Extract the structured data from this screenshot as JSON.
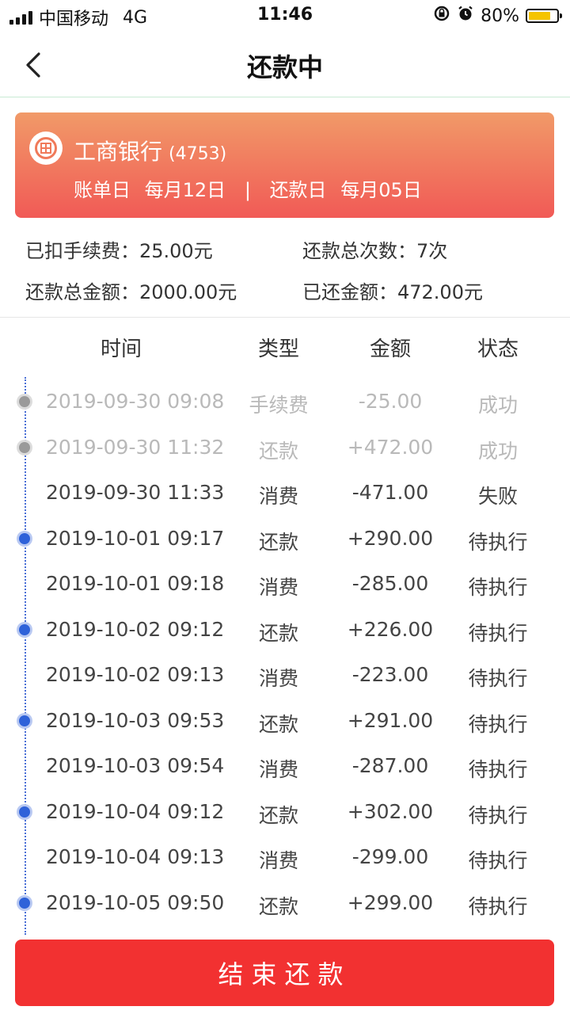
{
  "status_bar": {
    "carrier": "中国移动",
    "network": "4G",
    "time": "11:46",
    "battery": "80%",
    "battery_level": 0.8,
    "icons": [
      "signal-icon",
      "orientation-lock-icon",
      "alarm-icon",
      "battery-icon"
    ]
  },
  "nav": {
    "title": "还款中",
    "back_icon": "chevron-left-icon"
  },
  "card": {
    "bank_name": "工商银行",
    "card_no": "(4753)",
    "bill_label": "账单日",
    "bill_day": "每月12日",
    "separator": "|",
    "repay_label": "还款日",
    "repay_day": "每月05日",
    "gradient_colors": [
      "#f19a68",
      "#f15a56"
    ],
    "logo_icon": "icbc-logo-icon"
  },
  "summary": {
    "fee": "已扣手续费：25.00元",
    "count": "还款总次数：7次",
    "total": "还款总金额：2000.00元",
    "paid": "已还金额：472.00元"
  },
  "table": {
    "headers": [
      "时间",
      "类型",
      "金额",
      "状态"
    ],
    "rows": [
      {
        "time": "2019-09-30 09:08",
        "type": "手续费",
        "amount": "-25.00",
        "status": "成功"
      },
      {
        "time": "2019-09-30 11:32",
        "type": "还款",
        "amount": "+472.00",
        "status": "成功"
      },
      {
        "time": "2019-09-30 11:33",
        "type": "消费",
        "amount": "-471.00",
        "status": "失败"
      },
      {
        "time": "2019-10-01 09:17",
        "type": "还款",
        "amount": "+290.00",
        "status": "待执行"
      },
      {
        "time": "2019-10-01 09:18",
        "type": "消费",
        "amount": "-285.00",
        "status": "待执行"
      },
      {
        "time": "2019-10-02 09:12",
        "type": "还款",
        "amount": "+226.00",
        "status": "待执行"
      },
      {
        "time": "2019-10-02 09:13",
        "type": "消费",
        "amount": "-223.00",
        "status": "待执行"
      },
      {
        "time": "2019-10-03 09:53",
        "type": "还款",
        "amount": "+291.00",
        "status": "待执行"
      },
      {
        "time": "2019-10-03 09:54",
        "type": "消费",
        "amount": "-287.00",
        "status": "待执行"
      },
      {
        "time": "2019-10-04 09:12",
        "type": "还款",
        "amount": "+302.00",
        "status": "待执行"
      },
      {
        "time": "2019-10-04 09:13",
        "type": "消费",
        "amount": "-299.00",
        "status": "待执行"
      },
      {
        "time": "2019-10-05 09:50",
        "type": "还款",
        "amount": "+299.00",
        "status": "待执行"
      }
    ]
  },
  "button": {
    "end_label": "结束还款",
    "color": "#f23131"
  },
  "colors": {
    "accent": "#2f62d9",
    "muted": "#b9b9b9"
  }
}
